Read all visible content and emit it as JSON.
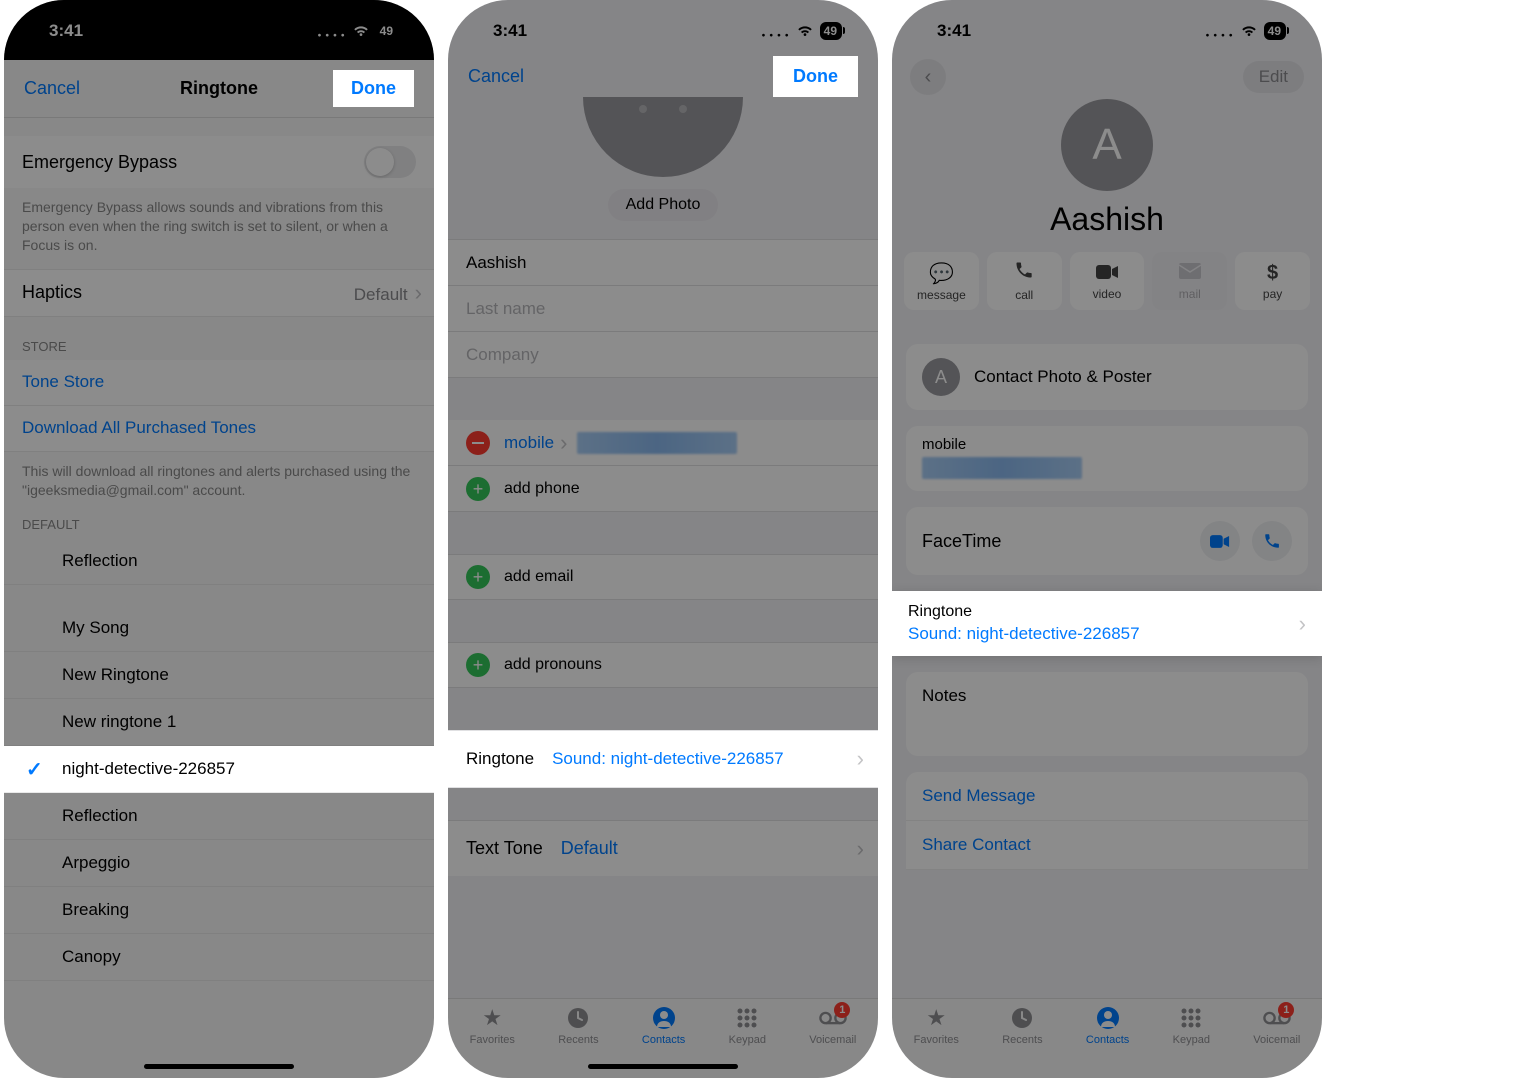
{
  "status": {
    "time": "3:41",
    "battery": "49"
  },
  "screen1": {
    "nav": {
      "cancel": "Cancel",
      "title": "Ringtone",
      "done": "Done"
    },
    "bypass": {
      "label": "Emergency Bypass",
      "desc": "Emergency Bypass allows sounds and vibrations from this person even when the ring switch is set to silent, or when a Focus is on."
    },
    "haptics": {
      "label": "Haptics",
      "value": "Default"
    },
    "store": {
      "header": "STORE",
      "tone_store": "Tone Store",
      "download": "Download All Purchased Tones",
      "desc": "This will download all ringtones and alerts purchased using the \"igeeksmedia@gmail.com\" account."
    },
    "default_header": "DEFAULT",
    "ringtones": {
      "r0": "Reflection",
      "r1": "My Song",
      "r2": "New Ringtone",
      "r3": "New ringtone 1",
      "r4": "night-detective-226857",
      "r5": "Reflection",
      "r6": "Arpeggio",
      "r7": "Breaking",
      "r8": "Canopy"
    }
  },
  "screen2": {
    "nav": {
      "cancel": "Cancel",
      "done": "Done"
    },
    "add_photo": "Add Photo",
    "first_name": "Aashish",
    "last_name_placeholder": "Last name",
    "company_placeholder": "Company",
    "mobile_label": "mobile",
    "add_phone": "add phone",
    "add_email": "add email",
    "add_pronouns": "add pronouns",
    "ringtone": {
      "label": "Ringtone",
      "value": "Sound: night-detective-226857"
    },
    "texttone": {
      "label": "Text Tone",
      "value": "Default"
    },
    "tabs": {
      "favorites": "Favorites",
      "recents": "Recents",
      "contacts": "Contacts",
      "keypad": "Keypad",
      "voicemail": "Voicemail",
      "badge": "1"
    }
  },
  "screen3": {
    "edit": "Edit",
    "initial": "A",
    "name": "Aashish",
    "actions": {
      "message": "message",
      "call": "call",
      "video": "video",
      "mail": "mail",
      "pay": "pay"
    },
    "photo_poster": "Contact Photo & Poster",
    "mobile": "mobile",
    "facetime": "FaceTime",
    "ringtone": {
      "label": "Ringtone",
      "value": "Sound: night-detective-226857"
    },
    "notes": "Notes",
    "send_message": "Send Message",
    "share_contact": "Share Contact"
  }
}
